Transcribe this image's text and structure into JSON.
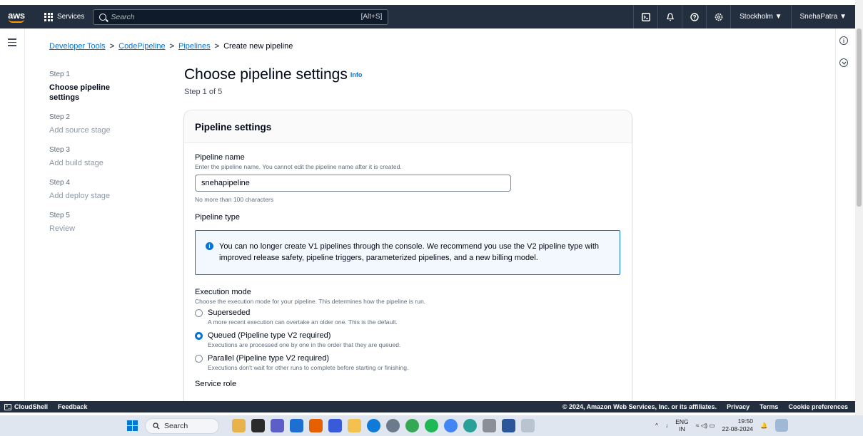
{
  "topnav": {
    "logo_text": "aws",
    "services_label": "Services",
    "search_placeholder": "Search",
    "search_shortcut": "[Alt+S]",
    "region": "Stockholm ▼",
    "account": "SnehaPatra ▼"
  },
  "breadcrumb": {
    "items": [
      "Developer Tools",
      "CodePipeline",
      "Pipelines"
    ],
    "current": "Create new pipeline",
    "separator": ">"
  },
  "steps": [
    {
      "num": "Step 1",
      "title": "Choose pipeline settings",
      "active": true
    },
    {
      "num": "Step 2",
      "title": "Add source stage",
      "active": false
    },
    {
      "num": "Step 3",
      "title": "Add build stage",
      "active": false
    },
    {
      "num": "Step 4",
      "title": "Add deploy stage",
      "active": false
    },
    {
      "num": "Step 5",
      "title": "Review",
      "active": false
    }
  ],
  "page": {
    "title": "Choose pipeline settings",
    "info_link": "Info",
    "subtitle": "Step 1 of 5"
  },
  "panel": {
    "header": "Pipeline settings",
    "name_label": "Pipeline name",
    "name_desc": "Enter the pipeline name. You cannot edit the pipeline name after it is created.",
    "name_value": "snehapipeline",
    "name_constraint": "No more than 100 characters",
    "type_label": "Pipeline type",
    "alert_text": "You can no longer create V1 pipelines through the console. We recommend you use the V2 pipeline type with improved release safety, pipeline triggers, parameterized pipelines, and a new billing model.",
    "exec_label": "Execution mode",
    "exec_desc": "Choose the execution mode for your pipeline. This determines how the pipeline is run.",
    "options": [
      {
        "label": "Superseded",
        "desc": "A more recent execution can overtake an older one. This is the default.",
        "checked": false
      },
      {
        "label": "Queued (Pipeline type V2 required)",
        "desc": "Executions are processed one by one in the order that they are queued.",
        "checked": true
      },
      {
        "label": "Parallel (Pipeline type V2 required)",
        "desc": "Executions don't wait for other runs to complete before starting or finishing.",
        "checked": false
      }
    ],
    "next_label_partial": "Service role"
  },
  "footer": {
    "cloudshell": "CloudShell",
    "feedback": "Feedback",
    "copyright": "© 2024, Amazon Web Services, Inc. or its affiliates.",
    "privacy": "Privacy",
    "terms": "Terms",
    "cookies": "Cookie preferences"
  },
  "taskbar": {
    "search": "Search",
    "lang_top": "ENG",
    "lang_bottom": "IN",
    "time": "19:50",
    "date": "22-08-2024"
  },
  "colors": {
    "nav_bg": "#232f3e",
    "link": "#0972d3",
    "accent": "#ff9900"
  }
}
